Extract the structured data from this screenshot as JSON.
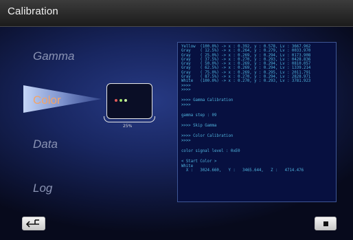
{
  "title": "Calibration",
  "menu": {
    "gamma": "Gamma",
    "color": "Color",
    "data": "Data",
    "log": "Log"
  },
  "progress": {
    "label": "25%",
    "value": 0.25
  },
  "colors": {
    "selected_menu": "#f3a468",
    "inactive_menu": "#8a93b3",
    "log_text": "#4fb2dc",
    "dot_red": "#e05a5a",
    "dot_green": "#9ee56a",
    "dot_lightgreen": "#c9f0a0"
  },
  "log_lines": [
    "Yellow  (100.0%) -> x : 0.392, y : 0.578, Lv : 3667.962",
    "Gray    ( 12.5%) -> x : 0.264, y : 0.279, Lv : 0033.970",
    "Gray    ( 25.0%) -> x : 0.269, y : 0.294, Lv : 0173.908",
    "Gray    ( 37.5%) -> x : 0.270, y : 0.293, Lv : 0428.836",
    "Gray    ( 50.0%) -> x : 0.269, y : 0.294, Lv : 0810.057",
    "Gray    ( 62.5%) -> x : 0.269, y : 0.294, Lv : 1339.214",
    "Gray    ( 75.0%) -> x : 0.269, y : 0.295, Lv : 2011.791",
    "Gray    ( 87.5%) -> x : 0.270, y : 0.294, Lv : 2828.971",
    "White   (100.0%) -> x : 0.270, y : 0.293, Lv : 3781.923",
    ">>>>",
    ">>>>",
    "",
    ">>>> Gamma Calibration",
    ">>>>",
    "",
    "gamma step : 09",
    "",
    ">>>> Skip Gamma",
    "",
    ">>>> Color Calibration",
    ">>>>",
    "",
    "color signal level : 0xE0",
    "",
    "< Start Color >",
    "White",
    "  X :   3024.660,   Y :   3465.644,   Z :   4714.476"
  ],
  "icons": {
    "back": "return-arrow-icon",
    "stop": "stop-icon",
    "display": "monitor-icon"
  }
}
